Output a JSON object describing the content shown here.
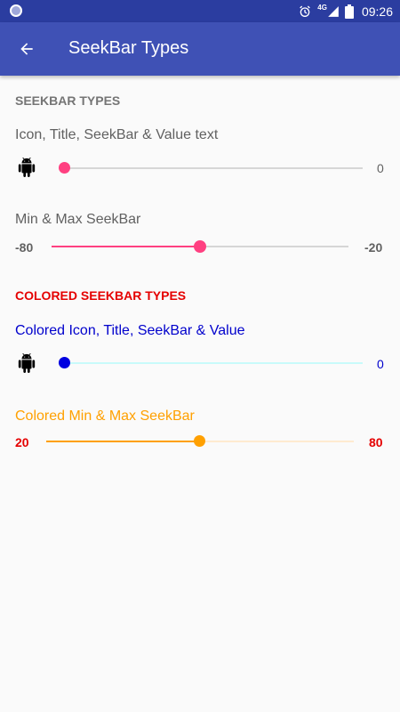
{
  "status_bar": {
    "time": "09:26",
    "network": "4G",
    "alarm_icon": "alarm-icon",
    "signal_icon": "cell-signal-icon",
    "battery_icon": "battery-icon"
  },
  "app_bar": {
    "title": "SeekBar Types",
    "back_icon": "arrow-back-icon",
    "background": "#3F51B5"
  },
  "section1": {
    "header": "SEEKBAR TYPES",
    "row1": {
      "title": "Icon, Title, SeekBar & Value text",
      "icon": "android-icon",
      "value_label": "0",
      "progress": 0
    },
    "row2": {
      "title": "Min & Max SeekBar",
      "min_label": "-80",
      "max_label": "-20",
      "progress": 0.5
    }
  },
  "section2": {
    "header": "COLORED SEEKBAR TYPES",
    "row1": {
      "title": "Colored Icon, Title, SeekBar & Value",
      "icon": "android-icon",
      "value_label": "0",
      "progress": 0
    },
    "row2": {
      "title": "Colored Min & Max SeekBar",
      "min_label": "20",
      "max_label": "80",
      "progress": 0.5
    }
  },
  "colors": {
    "accent_pink": "#FF4081",
    "header_gray": "#757575",
    "colored_header": "#E50000",
    "colored_blue": "#0000CC",
    "colored_orange": "#FFA000",
    "track_light_cyan": "#C8FAFA"
  }
}
